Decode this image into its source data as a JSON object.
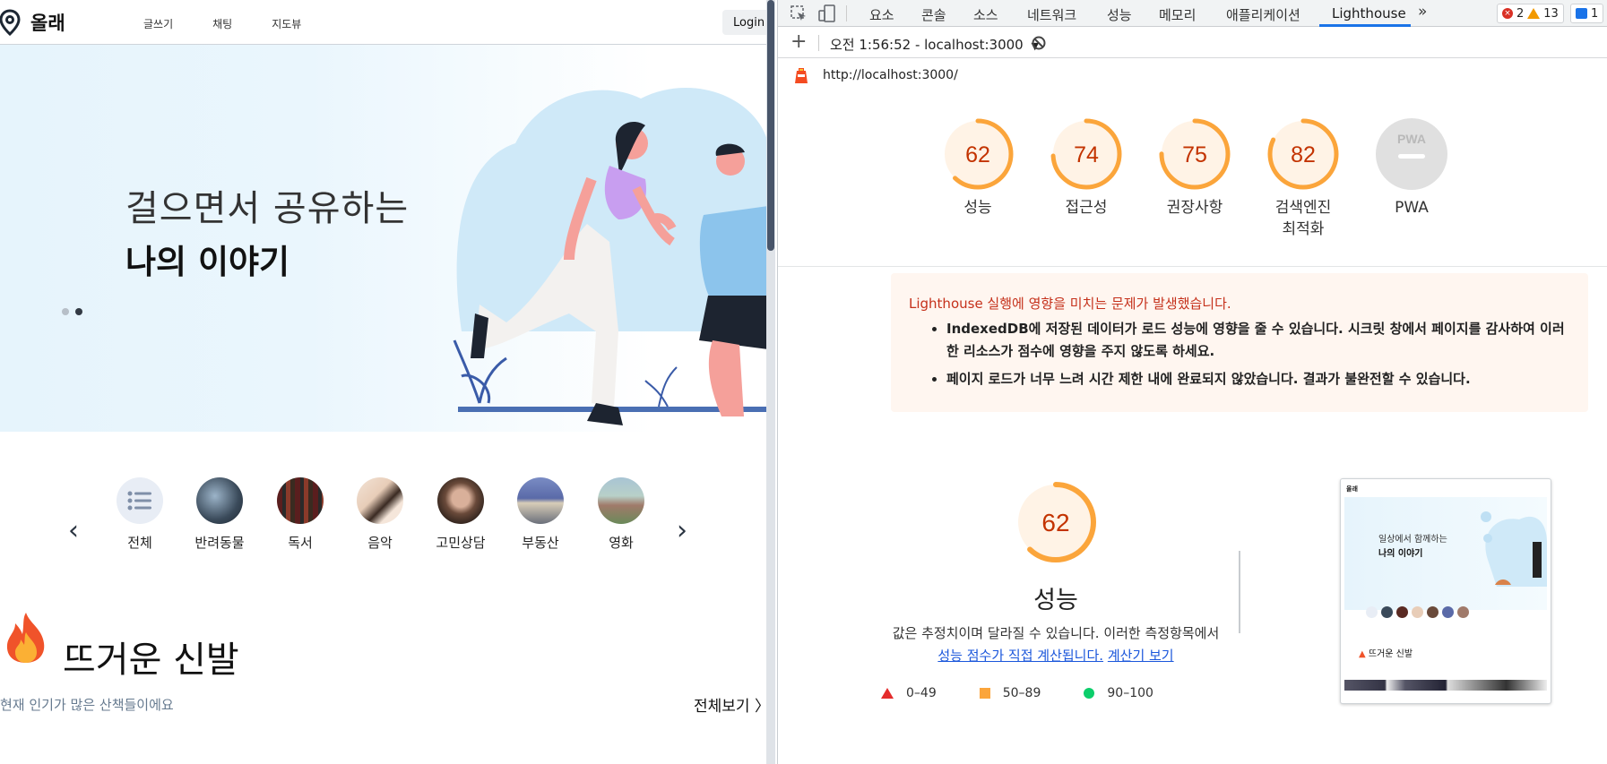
{
  "app": {
    "logo_text": "올래",
    "nav": [
      "글쓰기",
      "채팅",
      "지도뷰"
    ],
    "login_label": "Login",
    "hero": {
      "line1": "걸으면서 공유하는",
      "line2": "나의 이야기"
    },
    "categories": [
      "전체",
      "반려동물",
      "독서",
      "음악",
      "고민상담",
      "부동산",
      "영화"
    ],
    "hot_title": "뜨거운 신발",
    "hot_subtitle": "현재 인기가 많은 산책들이에요",
    "view_all": "전체보기 〉"
  },
  "devtools": {
    "tabs": [
      "요소",
      "콘솔",
      "소스",
      "네트워크",
      "성능",
      "메모리",
      "애플리케이션",
      "Lighthouse"
    ],
    "active_tab": "Lighthouse",
    "more_tabs": "»",
    "errors_count": "2",
    "warnings_count": "13",
    "messages_count": "1",
    "run_label": "오전 1:56:52 - localhost:3000",
    "url": "http://localhost:3000/",
    "scores": [
      {
        "label": "성능",
        "value": "62",
        "score": 62
      },
      {
        "label": "접근성",
        "value": "74",
        "score": 74
      },
      {
        "label": "권장사항",
        "value": "75",
        "score": 75
      },
      {
        "label": "검색엔진 최적화",
        "value": "82",
        "score": 82
      },
      {
        "label": "PWA",
        "value": "",
        "score": 0
      }
    ],
    "pwa_badge": "PWA",
    "warning": {
      "title": "Lighthouse 실행에 영향을 미치는 문제가 발생했습니다.",
      "items": [
        "IndexedDB에 저장된 데이터가 로드 성능에 영향을 줄 수 있습니다. 시크릿 창에서 페이지를 감사하여 이러한 리소스가 점수에 영향을 주지 않도록 하세요.",
        "페이지 로드가 너무 느려 시간 제한 내에 완료되지 않았습니다. 결과가 불완전할 수 있습니다."
      ]
    },
    "performance": {
      "score": "62",
      "title": "성능",
      "desc": "값은 추정치이며 달라질 수 있습니다. 이러한 측정항목에서",
      "link1": "성능 점수가 직접 계산됩니다.",
      "link2": "계산기 보기"
    },
    "legend": [
      "0–49",
      "50–89",
      "90–100"
    ],
    "thumbnail": {
      "line1": "일상에서 함께하는",
      "line2": "나의 이야기",
      "hot": "뜨거운 신발"
    }
  },
  "colors": {
    "score_orange": "#fba53b",
    "score_text_orange": "#c33300",
    "score_bg": "#fff3e6",
    "link_blue": "#1a56db",
    "active_tab_blue": "#1a73e8"
  }
}
